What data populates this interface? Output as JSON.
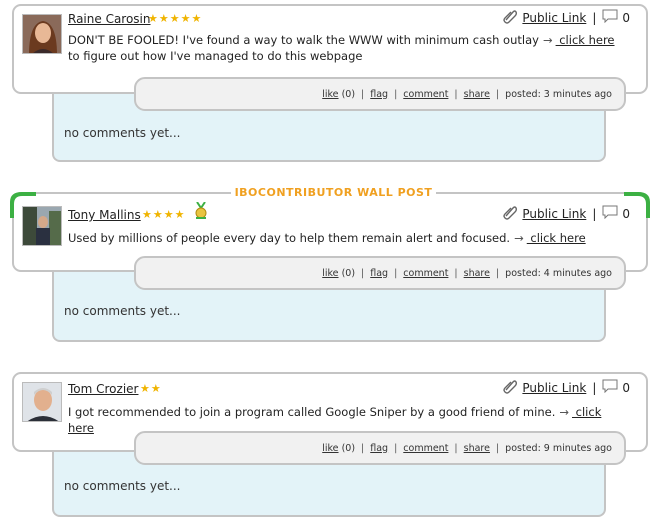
{
  "colors": {
    "accent_orange": "#f0a020",
    "star_gold": "#f0b400",
    "comment_bg": "#e3f3f8",
    "border": "#c4c4c4",
    "corner_green": "#3cb043"
  },
  "wall_header": "IBOCONTRIBUTOR WALL POST",
  "posts": [
    {
      "author": "Raine Carosin",
      "stars": "★★★★★",
      "avatar": "avatar-woman-brown-hair",
      "text": "DON'T BE FOOLED! I've found a way to walk the WWW with minimum cash outlay",
      "arrow": "→",
      "link_text": " click here",
      "text_after": " to figure out how I've managed to do this webpage",
      "public_link": "Public Link",
      "separator": "|",
      "comment_count": "0",
      "like": "like",
      "like_count": "(0)",
      "flag": "flag",
      "comment": "comment",
      "share": "share",
      "posted": "posted: 3 minutes ago",
      "no_comments": "no comments yet..."
    },
    {
      "author": "Tony Mallins",
      "stars": "★★★★",
      "badge": "medal-icon",
      "avatar": "avatar-man-outdoors",
      "text": "Used by millions of people every day to help them remain alert and focused.",
      "arrow": "→",
      "link_text": " click here",
      "text_after": "",
      "public_link": "Public Link",
      "separator": "|",
      "comment_count": "0",
      "like": "like",
      "like_count": "(0)",
      "flag": "flag",
      "comment": "comment",
      "share": "share",
      "posted": "posted: 4 minutes ago",
      "no_comments": "no comments yet..."
    },
    {
      "author": "Tom Crozier",
      "stars": "★★",
      "avatar": "avatar-man-suit",
      "text": "I got recommended to join a program called Google Sniper by a good friend of mine.",
      "arrow": "→",
      "link_text": " click here",
      "text_after": "",
      "public_link": "Public Link",
      "separator": "|",
      "comment_count": "0",
      "like": "like",
      "like_count": "(0)",
      "flag": "flag",
      "comment": "comment",
      "share": "share",
      "posted": "posted: 9 minutes ago",
      "no_comments": "no comments yet..."
    }
  ]
}
